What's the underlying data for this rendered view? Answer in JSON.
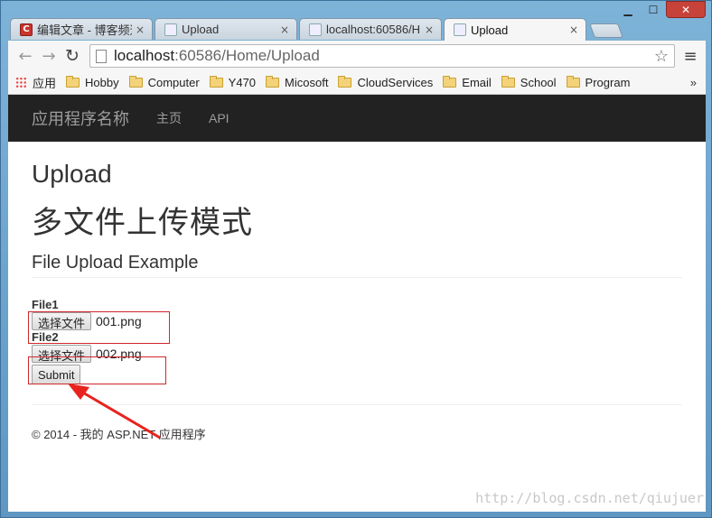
{
  "browser": {
    "tabs": [
      {
        "label": "编辑文章 - 博客频道",
        "icon": "csdn-icon",
        "active": false
      },
      {
        "label": "Upload",
        "icon": "page-icon",
        "active": false
      },
      {
        "label": "localhost:60586/H",
        "icon": "page-icon",
        "active": false
      },
      {
        "label": "Upload",
        "icon": "page-icon",
        "active": true
      }
    ],
    "tab_close": "×",
    "url_host": "localhost",
    "url_path": ":60586/Home/Upload",
    "bookmarks": [
      {
        "label": "应用",
        "icon": "apps-icon"
      },
      {
        "label": "Hobby",
        "icon": "folder-icon"
      },
      {
        "label": "Computer",
        "icon": "folder-icon"
      },
      {
        "label": "Y470",
        "icon": "folder-icon"
      },
      {
        "label": "Micosoft",
        "icon": "folder-icon"
      },
      {
        "label": "CloudServices",
        "icon": "folder-icon"
      },
      {
        "label": "Email",
        "icon": "folder-icon"
      },
      {
        "label": "School",
        "icon": "folder-icon"
      },
      {
        "label": "Program",
        "icon": "folder-icon"
      }
    ],
    "bookmarks_more": "»"
  },
  "navbar": {
    "brand": "应用程序名称",
    "links": [
      "主页",
      "API"
    ]
  },
  "page": {
    "title": "Upload",
    "subtitle": "多文件上传模式",
    "example_heading": "File Upload Example",
    "fields": [
      {
        "label": "File1",
        "button": "选择文件",
        "file": "001.png"
      },
      {
        "label": "File2",
        "button": "选择文件",
        "file": "002.png"
      }
    ],
    "submit": "Submit",
    "footer": "© 2014 - 我的 ASP.NET 应用程序"
  },
  "watermark": "http://blog.csdn.net/qiujuer",
  "colors": {
    "navbar_bg": "#222222",
    "annotation_red": "#d0262b"
  }
}
